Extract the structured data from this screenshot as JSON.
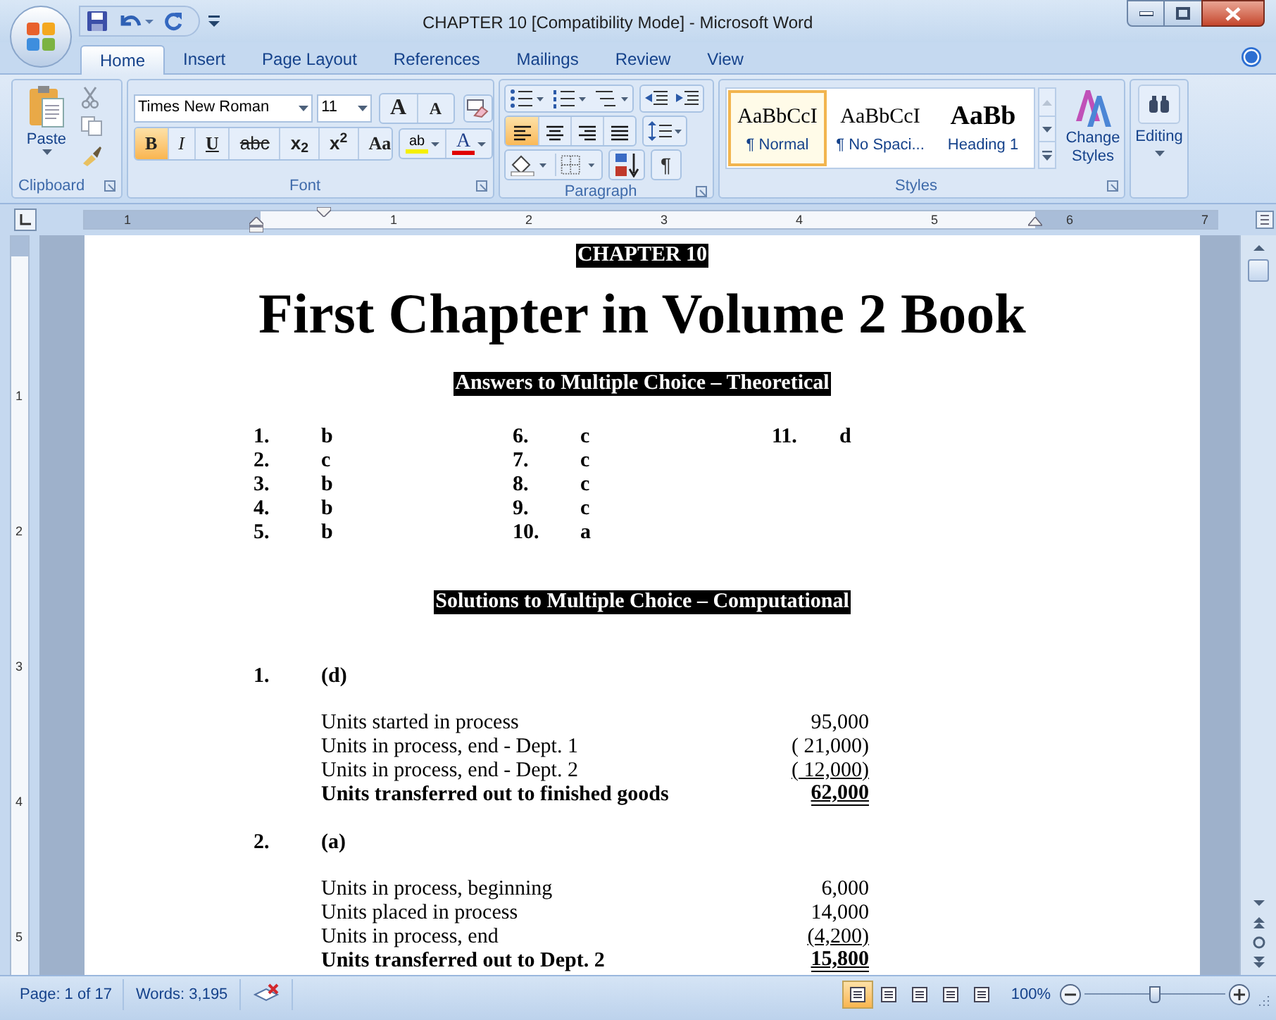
{
  "window": {
    "title": "CHAPTER 10 [Compatibility Mode] - Microsoft Word"
  },
  "tabs": [
    {
      "label": "Home",
      "selected": true
    },
    {
      "label": "Insert",
      "selected": false
    },
    {
      "label": "Page Layout",
      "selected": false
    },
    {
      "label": "References",
      "selected": false
    },
    {
      "label": "Mailings",
      "selected": false
    },
    {
      "label": "Review",
      "selected": false
    },
    {
      "label": "View",
      "selected": false
    }
  ],
  "clipboard": {
    "paste": "Paste",
    "label": "Clipboard"
  },
  "font": {
    "name": "Times New Roman",
    "size": "11",
    "label": "Font",
    "size_buttons": [
      {
        "kind": "grow",
        "glyph": "A"
      },
      {
        "kind": "shrink",
        "glyph": "A"
      }
    ],
    "format_buttons": [
      {
        "kind": "bold",
        "glyph": "B",
        "on": true
      },
      {
        "kind": "italic",
        "glyph": "I",
        "on": false
      },
      {
        "kind": "underline",
        "glyph": "U",
        "on": false
      },
      {
        "kind": "strike",
        "glyph": "abc",
        "on": false
      },
      {
        "kind": "subscript",
        "glyph": "x$_{2}$",
        "on": false
      },
      {
        "kind": "superscript",
        "glyph": "x$^{2}$",
        "on": false
      },
      {
        "kind": "case",
        "glyph": "Aa",
        "on": false
      }
    ],
    "highlight_glyph": "ab",
    "color_glyph": "A"
  },
  "paragraph": {
    "label": "Paragraph",
    "alignments": [
      {
        "kind": "left",
        "selected": true
      },
      {
        "kind": "center",
        "selected": false
      },
      {
        "kind": "right",
        "selected": false
      },
      {
        "kind": "justify",
        "selected": false
      }
    ],
    "pilcrow": "¶"
  },
  "styles": {
    "label": "Styles",
    "gallery": [
      {
        "preview": "AaBbCcI",
        "name": "¶ Normal",
        "selected": true,
        "kind": "body"
      },
      {
        "preview": "AaBbCcI",
        "name": "¶ No Spaci...",
        "selected": false,
        "kind": "body"
      },
      {
        "preview": "AaBb",
        "name": "Heading 1",
        "selected": false,
        "kind": "heading"
      }
    ],
    "change_styles": "Change Styles"
  },
  "editing": {
    "label": "Editing"
  },
  "ruler": {
    "horizontal": [
      "1",
      "1",
      "2",
      "3",
      "4",
      "5",
      "6",
      "7"
    ],
    "vertical": [
      "1",
      "2",
      "3",
      "4",
      "5"
    ]
  },
  "document": {
    "chapter": "CHAPTER 10",
    "title": "First Chapter in Volume 2 Book",
    "answers_heading": "Answers to Multiple Choice – Theoretical",
    "answer_columns": [
      [
        {
          "num": "1.",
          "answer": "b"
        },
        {
          "num": "2.",
          "answer": "c"
        },
        {
          "num": "3.",
          "answer": "b"
        },
        {
          "num": "4.",
          "answer": "b"
        },
        {
          "num": "5.",
          "answer": "b"
        }
      ],
      [
        {
          "num": "6.",
          "answer": "c"
        },
        {
          "num": "7.",
          "answer": "c"
        },
        {
          "num": "8.",
          "answer": "c"
        },
        {
          "num": "9.",
          "answer": "c"
        },
        {
          "num": "10.",
          "answer": "a"
        }
      ],
      [
        {
          "num": "11.",
          "answer": "d"
        }
      ]
    ],
    "solutions_heading": "Solutions to Multiple Choice – Computational",
    "problems": [
      {
        "num": "1.",
        "answer": "(d)",
        "lines": [
          {
            "label": "Units started in process",
            "amount": "95,000",
            "total": false,
            "underlined": false,
            "double_underlined": false
          },
          {
            "label": "Units in process, end - Dept. 1",
            "amount": "( 21,000)",
            "total": false,
            "underlined": false,
            "double_underlined": false
          },
          {
            "label": "Units in process, end - Dept. 2",
            "amount": "( 12,000)",
            "total": false,
            "underlined": true,
            "double_underlined": false
          },
          {
            "label": "Units transferred out to finished goods",
            "amount": "62,000",
            "total": true,
            "underlined": true,
            "double_underlined": true
          }
        ]
      },
      {
        "num": "2.",
        "answer": "(a)",
        "lines": [
          {
            "label": "Units in process, beginning",
            "amount": "6,000",
            "total": false,
            "underlined": false,
            "double_underlined": false
          },
          {
            "label": "Units placed in process",
            "amount": "14,000",
            "total": false,
            "underlined": false,
            "double_underlined": false
          },
          {
            "label": "Units in process, end",
            "amount": "(4,200)",
            "total": false,
            "underlined": true,
            "double_underlined": false
          },
          {
            "label": "Units transferred out to Dept. 2",
            "amount": "15,800",
            "total": true,
            "underlined": true,
            "double_underlined": true
          }
        ]
      }
    ]
  },
  "status_bar": {
    "page": "Page: 1 of 17",
    "words": "Words: 3,195",
    "views": [
      {
        "selected": true
      },
      {
        "selected": false
      },
      {
        "selected": false
      },
      {
        "selected": false
      },
      {
        "selected": false
      }
    ],
    "zoom": {
      "reading": "100%",
      "level": 0.5
    }
  }
}
